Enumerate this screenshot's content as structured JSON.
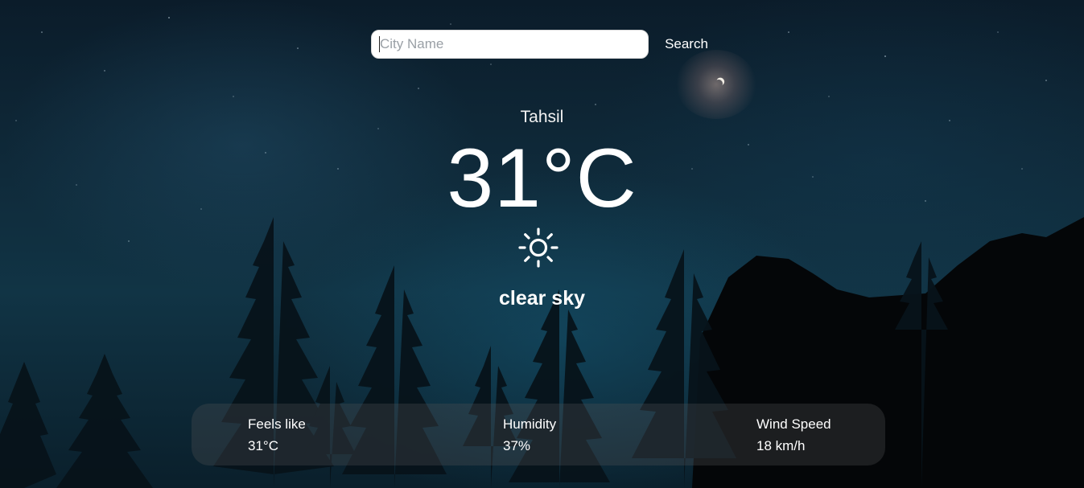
{
  "search": {
    "placeholder": "City Name",
    "button_label": "Search"
  },
  "weather": {
    "city": "Tahsil",
    "temperature": "31°C",
    "icon": "sun-icon",
    "description": "clear sky"
  },
  "details": [
    {
      "label": "Feels like",
      "value": "31°C"
    },
    {
      "label": "Humidity",
      "value": "37%"
    },
    {
      "label": "Wind Speed",
      "value": "18 km/h"
    }
  ],
  "colors": {
    "text": "#ffffff",
    "panel": "rgba(80,80,84,0.32)",
    "input_bg": "#ffffff"
  }
}
